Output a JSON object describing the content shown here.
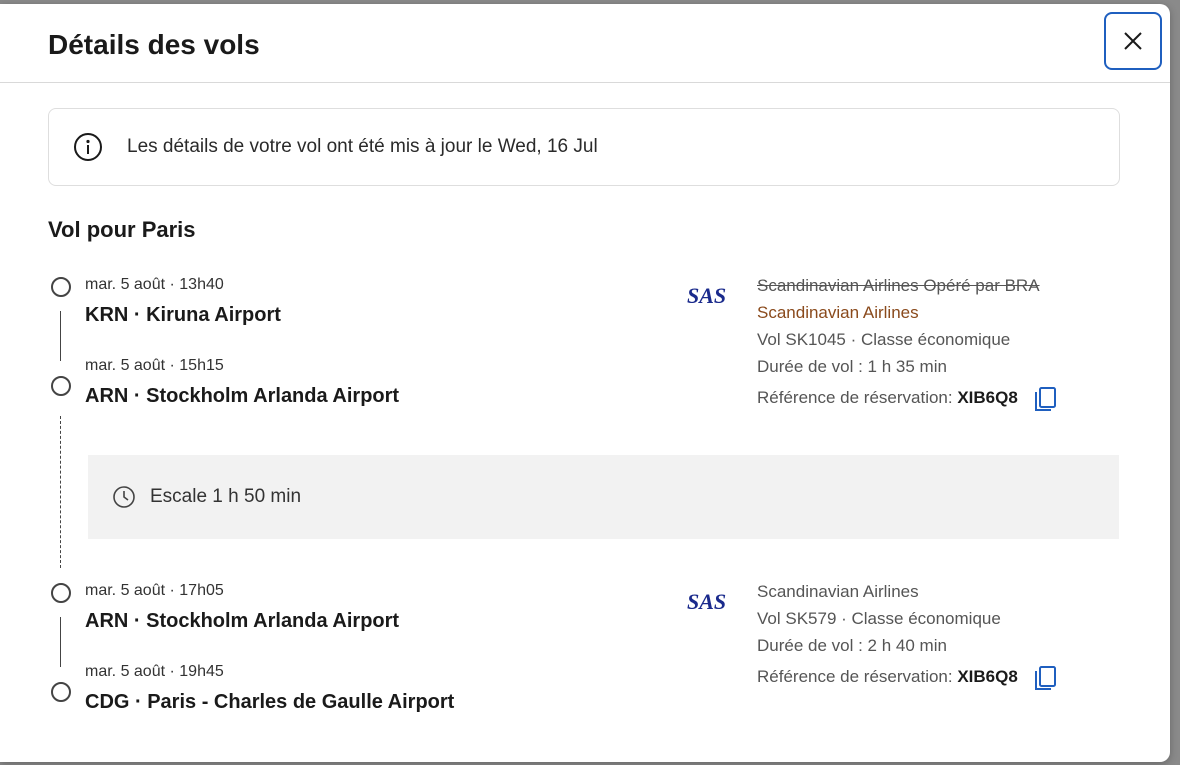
{
  "modal": {
    "title": "Détails des vols",
    "close_icon": "close-icon"
  },
  "notice": {
    "icon": "info-icon",
    "text": "Les détails de votre vol ont été mis à jour le Wed, 16 Jul"
  },
  "section_title": "Vol pour Paris",
  "segments": [
    {
      "departure_time": "mar. 5 août · 13h40",
      "departure_airport": "KRN · Kiruna Airport",
      "arrival_time": "mar. 5 août · 15h15",
      "arrival_airport": "ARN · Stockholm Arlanda Airport",
      "airline_logo": "SAS",
      "airline_struck": "Scandinavian Airlines Opéré par BRA",
      "airline": "Scandinavian Airlines",
      "flight": "Vol SK1045 · Classe économique",
      "duration": "Durée de vol : 1 h 35 min",
      "ref_label": "Référence de réservation:",
      "ref_value": "XIB6Q8"
    },
    {
      "departure_time": "mar. 5 août · 17h05",
      "departure_airport": "ARN · Stockholm Arlanda Airport",
      "arrival_time": "mar. 5 août · 19h45",
      "arrival_airport": "CDG · Paris - Charles de Gaulle Airport",
      "airline_logo": "SAS",
      "airline": "Scandinavian Airlines",
      "flight": "Vol SK579 · Classe économique",
      "duration": "Durée de vol : 2 h 40 min",
      "ref_label": "Référence de réservation:",
      "ref_value": "XIB6Q8"
    }
  ],
  "layover": {
    "icon": "clock-icon",
    "text": "Escale 1 h 50 min"
  },
  "colors": {
    "accent": "#1f5fbf",
    "sas_blue": "#1a2a8c",
    "changed": "#8a4a1c"
  }
}
